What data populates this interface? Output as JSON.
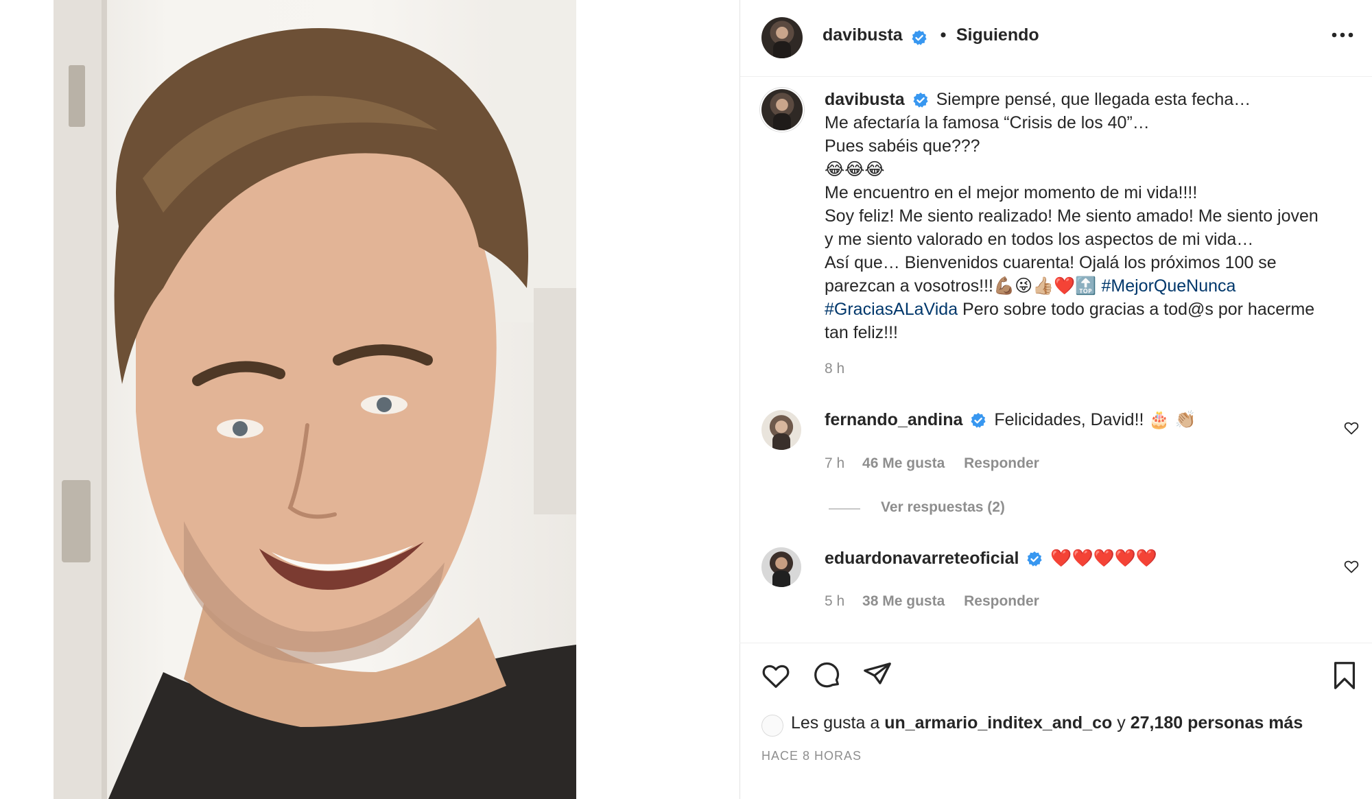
{
  "post": {
    "author": "davibusta",
    "follow_status": "Siguiendo",
    "separator": "•",
    "more_icon": "more-horizontal-icon"
  },
  "caption": {
    "author": "davibusta",
    "lines": [
      "Siempre pensé, que llegada esta fecha…",
      "Me afectaría la famosa “Crisis de los 40”…",
      "Pues sabéis que???",
      "😂😂😂",
      "Me encuentro en el mejor momento de mi vida!!!!",
      "Soy feliz! Me siento realizado! Me siento amado! Me siento joven",
      "y me siento valorado en todos los aspectos de mi vida…",
      "Así que… Bienvenidos cuarenta! Ojalá los próximos 100 se",
      "parezcan a vosotros!!!💪🏽😜👍🏼❤️🔝"
    ],
    "hashtag_1": "#MejorQueNunca",
    "hashtag_2": "#GraciasALaVida",
    "after_hashtag": " Pero sobre todo gracias a tod@s por hacerme",
    "last_line": "tan feliz!!!",
    "time": "8 h"
  },
  "comments": [
    {
      "username": "fernando_andina",
      "text": "Felicidades, David!! 🎂 👏🏼",
      "time": "7 h",
      "likes": "46 Me gusta",
      "reply": "Responder"
    },
    {
      "username": "eduardonavarreteoficial",
      "text": "❤️❤️❤️❤️❤️",
      "time": "5 h",
      "likes": "38 Me gusta",
      "reply": "Responder"
    }
  ],
  "view_replies": "Ver respuestas (2)",
  "likes_summary": {
    "prefix": "Les gusta a ",
    "user": "un_armario_inditex_and_co",
    "middle": " y ",
    "count": "27,180 personas más"
  },
  "time_ago": "HACE 8 HORAS",
  "colors": {
    "verified_blue": "#3897f0",
    "hashtag_blue": "#00376b",
    "secondary_text": "#8e8e8e",
    "border": "#efefef"
  }
}
